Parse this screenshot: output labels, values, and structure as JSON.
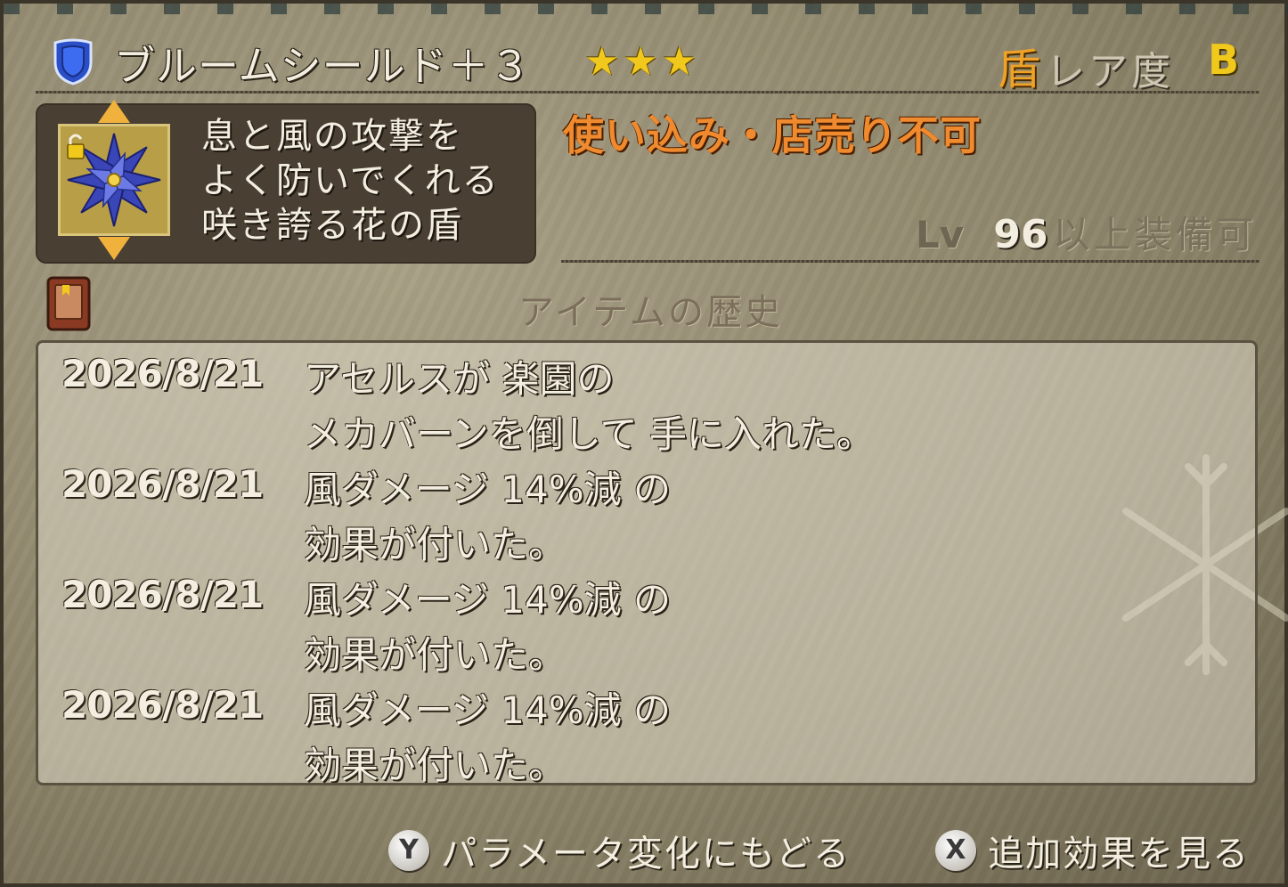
{
  "item": {
    "name": "ブルームシールド＋３",
    "stars": "★★★",
    "category_icon": "盾",
    "rarity_label": "レア度",
    "rarity_value": "B",
    "icon": "shield-icon",
    "image_icon": "bloom-flower-shield-icon",
    "description": [
      "息と風の攻撃を",
      "よく防いでくれる",
      "咲き誇る花の盾"
    ],
    "restriction": "使い込み・店売り不可",
    "level_label": "Lv",
    "level_value": "96",
    "level_suffix": "以上装備可"
  },
  "history": {
    "title": "アイテムの歴史",
    "icon": "book-icon",
    "entries": [
      {
        "date": "2026/8/21",
        "lines": [
          "アセルスが 楽園の",
          "メカバーンを倒して 手に入れた。"
        ]
      },
      {
        "date": "2026/8/21",
        "lines": [
          "風ダメージ 14%減 の",
          "効果が付いた。"
        ]
      },
      {
        "date": "2026/8/21",
        "lines": [
          "風ダメージ 14%減 の",
          "効果が付いた。"
        ]
      },
      {
        "date": "2026/8/21",
        "lines": [
          "風ダメージ 14%減 の",
          "効果が付いた。"
        ]
      }
    ]
  },
  "footer": {
    "y_button": "Y",
    "y_label": "パラメータ変化にもどる",
    "x_button": "X",
    "x_label": "追加効果を見る"
  },
  "colors": {
    "rarity": "#f1c81c",
    "restriction": "#f08a2e",
    "category": "#f0a226"
  }
}
